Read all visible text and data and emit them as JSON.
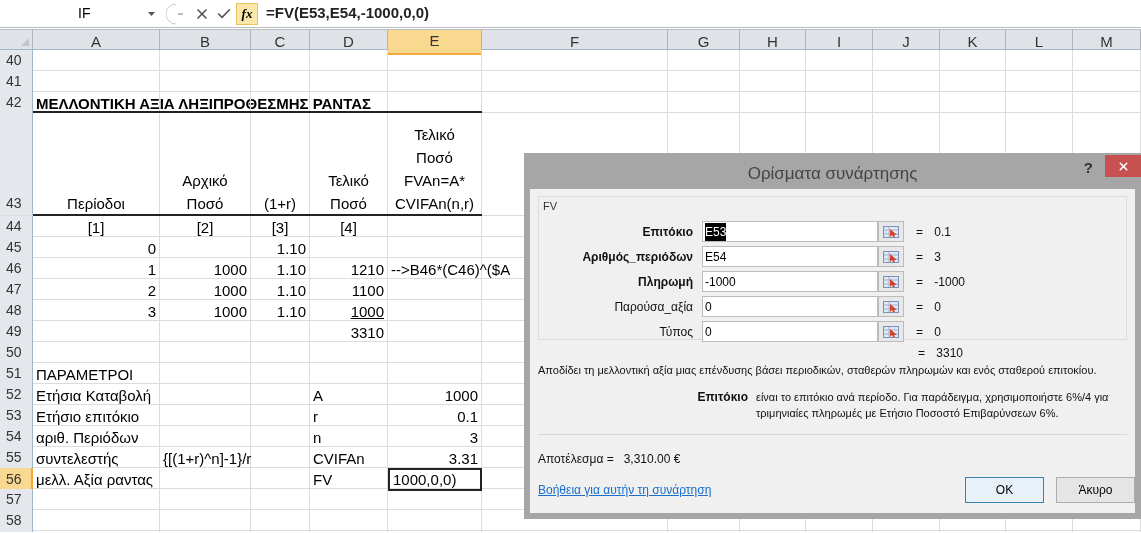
{
  "formula_bar": {
    "name_box": "IF",
    "fx_label": "fx",
    "formula": "=FV(E53,E54,-1000,0,0)"
  },
  "columns": [
    {
      "label": "A",
      "selected": false
    },
    {
      "label": "B",
      "selected": false
    },
    {
      "label": "C",
      "selected": false
    },
    {
      "label": "D",
      "selected": false
    },
    {
      "label": "E",
      "selected": true
    },
    {
      "label": "F",
      "selected": false
    },
    {
      "label": "G",
      "selected": false
    },
    {
      "label": "H",
      "selected": false
    },
    {
      "label": "I",
      "selected": false
    },
    {
      "label": "J",
      "selected": false
    },
    {
      "label": "K",
      "selected": false
    },
    {
      "label": "L",
      "selected": false
    },
    {
      "label": "M",
      "selected": false
    }
  ],
  "rows": [
    {
      "number": "40",
      "selected": false,
      "kind": "normal",
      "ruled": false
    },
    {
      "number": "41",
      "selected": false,
      "kind": "normal",
      "ruled": false
    },
    {
      "number": "42",
      "selected": false,
      "kind": "normal",
      "ruled": true,
      "cells": {
        "A": {
          "text": "ΜΕΛΛΟΝΤΙΚΗ ΑΞΙΑ ΛΗΞΙΠΡΟΘΕΣΜΗΣ ΡΑΝΤΑΣ",
          "kind": "title",
          "underlined": false,
          "selected": false
        }
      }
    },
    {
      "number": "43",
      "selected": false,
      "kind": "header",
      "ruled": true,
      "cells": {
        "A": {
          "text": "Περίοδοι",
          "kind": "header",
          "underlined": false,
          "selected": false
        },
        "B": {
          "text": "Αρχικό\nΠοσό",
          "kind": "header",
          "underlined": false,
          "selected": false
        },
        "C": {
          "text": "(1+r)",
          "kind": "header",
          "underlined": false,
          "selected": false
        },
        "D": {
          "text": "Τελικό\nΠοσό",
          "kind": "header",
          "underlined": false,
          "selected": false
        },
        "E": {
          "text": "Τελικό\nΠοσό\nFVAn=A*\nCVIFAn(n,r)",
          "kind": "header",
          "underlined": false,
          "selected": false
        }
      }
    },
    {
      "number": "44",
      "selected": false,
      "kind": "normal",
      "ruled": false,
      "cells": {
        "A": {
          "text": "[1]",
          "kind": "label",
          "underlined": false,
          "selected": false
        },
        "B": {
          "text": "[2]",
          "kind": "label",
          "underlined": false,
          "selected": false
        },
        "C": {
          "text": "[3]",
          "kind": "label",
          "underlined": false,
          "selected": false
        },
        "D": {
          "text": "[4]",
          "kind": "label",
          "underlined": false,
          "selected": false
        }
      }
    },
    {
      "number": "45",
      "selected": false,
      "kind": "normal",
      "ruled": false,
      "cells": {
        "A": {
          "text": "0",
          "kind": "number",
          "underlined": false,
          "selected": false
        },
        "C": {
          "text": "1.10",
          "kind": "number",
          "underlined": false,
          "selected": false
        }
      }
    },
    {
      "number": "46",
      "selected": false,
      "kind": "normal",
      "ruled": false,
      "cells": {
        "A": {
          "text": "1",
          "kind": "number",
          "underlined": false,
          "selected": false
        },
        "B": {
          "text": "1000",
          "kind": "number",
          "underlined": false,
          "selected": false
        },
        "C": {
          "text": "1.10",
          "kind": "number",
          "underlined": false,
          "selected": false
        },
        "D": {
          "text": "1210",
          "kind": "number",
          "underlined": false,
          "selected": false
        },
        "E": {
          "text": "-->B46*(C46)^($A",
          "kind": "note",
          "underlined": false,
          "selected": false
        }
      }
    },
    {
      "number": "47",
      "selected": false,
      "kind": "normal",
      "ruled": false,
      "cells": {
        "A": {
          "text": "2",
          "kind": "number",
          "underlined": false,
          "selected": false
        },
        "B": {
          "text": "1000",
          "kind": "number",
          "underlined": false,
          "selected": false
        },
        "C": {
          "text": "1.10",
          "kind": "number",
          "underlined": false,
          "selected": false
        },
        "D": {
          "text": "1100",
          "kind": "number",
          "underlined": false,
          "selected": false
        }
      }
    },
    {
      "number": "48",
      "selected": false,
      "kind": "normal",
      "ruled": false,
      "cells": {
        "A": {
          "text": "3",
          "kind": "number",
          "underlined": false,
          "selected": false
        },
        "B": {
          "text": "1000",
          "kind": "number",
          "underlined": false,
          "selected": false
        },
        "C": {
          "text": "1.10",
          "kind": "number",
          "underlined": false,
          "selected": false
        },
        "D": {
          "text": "1000",
          "kind": "number",
          "underlined": true,
          "selected": false
        }
      }
    },
    {
      "number": "49",
      "selected": false,
      "kind": "normal",
      "ruled": false,
      "cells": {
        "D": {
          "text": "3310",
          "kind": "number",
          "underlined": false,
          "selected": false
        }
      }
    },
    {
      "number": "50",
      "selected": false,
      "kind": "normal",
      "ruled": false
    },
    {
      "number": "51",
      "selected": false,
      "kind": "normal",
      "ruled": false,
      "cells": {
        "A": {
          "text": "ΠΑΡΑΜΕΤΡΟΙ",
          "kind": "text",
          "underlined": false,
          "selected": false
        }
      }
    },
    {
      "number": "52",
      "selected": false,
      "kind": "normal",
      "ruled": false,
      "cells": {
        "A": {
          "text": "Ετήσια Καταβολή",
          "kind": "text",
          "underlined": false,
          "selected": false
        },
        "D": {
          "text": "A",
          "kind": "text",
          "underlined": false,
          "selected": false
        },
        "E": {
          "text": "1000",
          "kind": "number",
          "underlined": false,
          "selected": false
        }
      }
    },
    {
      "number": "53",
      "selected": false,
      "kind": "normal",
      "ruled": false,
      "cells": {
        "A": {
          "text": "Ετήσιο επιτόκιο",
          "kind": "text",
          "underlined": false,
          "selected": false
        },
        "D": {
          "text": "r",
          "kind": "text",
          "underlined": false,
          "selected": false
        },
        "E": {
          "text": "0.1",
          "kind": "number",
          "underlined": false,
          "selected": false
        }
      }
    },
    {
      "number": "54",
      "selected": false,
      "kind": "normal",
      "ruled": false,
      "cells": {
        "A": {
          "text": "αριθ. Περιόδων",
          "kind": "text",
          "underlined": false,
          "selected": false
        },
        "D": {
          "text": "n",
          "kind": "text",
          "underlined": false,
          "selected": false
        },
        "E": {
          "text": "3",
          "kind": "number",
          "underlined": false,
          "selected": false
        }
      }
    },
    {
      "number": "55",
      "selected": false,
      "kind": "normal",
      "ruled": false,
      "cells": {
        "A": {
          "text": "συντελεστής",
          "kind": "text",
          "underlined": false,
          "selected": false
        },
        "B": {
          "text": "{[(1+r)^n]-1}/r",
          "kind": "text",
          "underlined": false,
          "selected": false
        },
        "D": {
          "text": "CVIFAn",
          "kind": "text",
          "underlined": false,
          "selected": false
        },
        "E": {
          "text": "3.31",
          "kind": "number",
          "underlined": false,
          "selected": false
        }
      }
    },
    {
      "number": "56",
      "selected": true,
      "kind": "normal",
      "ruled": false,
      "cells": {
        "A": {
          "text": "μελλ. Αξία ραντας",
          "kind": "text",
          "underlined": false,
          "selected": false
        },
        "D": {
          "text": "FV",
          "kind": "text",
          "underlined": false,
          "selected": false
        },
        "E": {
          "text": "1000,0,0)",
          "kind": "text",
          "underlined": false,
          "selected": true
        }
      }
    },
    {
      "number": "57",
      "selected": false,
      "kind": "normal",
      "ruled": false
    },
    {
      "number": "58",
      "selected": false,
      "kind": "normal",
      "ruled": false
    }
  ],
  "dialog": {
    "title": "Ορίσματα συνάρτησης",
    "help_button": "?",
    "function_name": "FV",
    "arguments": [
      {
        "name": "Επιτόκιο",
        "value": "E53",
        "result": "= 0.1",
        "required": true,
        "text_selected": true
      },
      {
        "name": "Αριθμός_περιόδων",
        "value": "E54",
        "result": "= 3",
        "required": true,
        "text_selected": false
      },
      {
        "name": "Πληρωμή",
        "value": "-1000",
        "result": "= -1000",
        "required": true,
        "text_selected": false
      },
      {
        "name": "Παρούσα_αξία",
        "value": "0",
        "result": "= 0",
        "required": false,
        "text_selected": false
      },
      {
        "name": "Τύπος",
        "value": "0",
        "result": "= 0",
        "required": false,
        "text_selected": false
      }
    ],
    "formula_result": "= 3310",
    "description": "Αποδίδει τη μελλοντική αξία μιας επένδυσης βάσει περιοδικών, σταθερών πληρωμών και ενός σταθερού επιτοκίου.",
    "argument_help": {
      "name": "Επιτόκιο",
      "text": "είναι το επιτόκιο ανά περίοδο. Για παράδειγμα, χρησιμοποιήστε 6%/4 για τριμηνιαίες πληρωμές με Ετήσιο Ποσοστό Επιβαρύνσεων 6%."
    },
    "result": "Αποτέλεσμα =   3,310.00 €",
    "help_link": "Βοήθεια για αυτήν τη συνάρτηση",
    "buttons": [
      {
        "label": "OK",
        "default": true
      },
      {
        "label": "Άκυρο",
        "default": false
      }
    ]
  }
}
